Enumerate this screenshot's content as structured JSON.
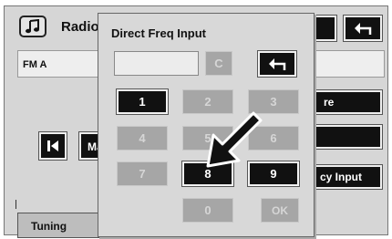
{
  "header": {
    "title": "Radio",
    "icon": "music-note-icon"
  },
  "station": {
    "band": "FM A"
  },
  "background_buttons": {
    "partial_store": "re",
    "partial_ma": "Ma",
    "partial_direct": "cy Input",
    "tuning_tab": "Tuning"
  },
  "popup": {
    "title": "Direct Freq Input",
    "display_value": "",
    "clear_label": "C",
    "ok_label": "OK",
    "keys": [
      {
        "label": "1",
        "enabled": true
      },
      {
        "label": "2",
        "enabled": false
      },
      {
        "label": "3",
        "enabled": false
      },
      {
        "label": "4",
        "enabled": false
      },
      {
        "label": "5",
        "enabled": false
      },
      {
        "label": "6",
        "enabled": false
      },
      {
        "label": "7",
        "enabled": false
      },
      {
        "label": "8",
        "enabled": true
      },
      {
        "label": "9",
        "enabled": true
      },
      {
        "label": "0",
        "enabled": false
      }
    ]
  },
  "colors": {
    "panel": "#d8d8d8",
    "key_active": "#111111",
    "key_disabled": "#a6a6a6"
  }
}
